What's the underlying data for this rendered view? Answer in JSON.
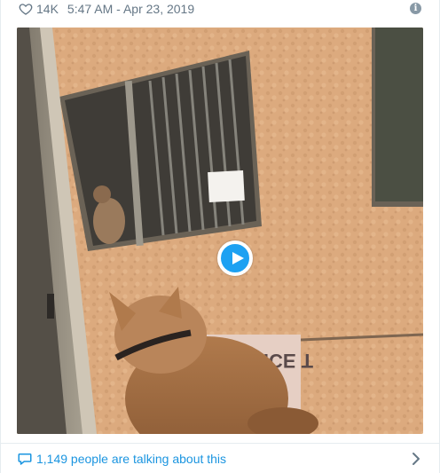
{
  "meta": {
    "like_count": "14K",
    "timestamp": "5:47 AM - Apr 23, 2019",
    "info_symbol": "i"
  },
  "media": {
    "type": "video",
    "sign_text": "NICE T"
  },
  "footer": {
    "conversation_text": "1,149 people are talking about this"
  },
  "colors": {
    "link": "#1b95e0",
    "play_button": "#1da1f2",
    "muted": "#657786",
    "wall": "#d9a679"
  },
  "icons": {
    "like": "heart-icon",
    "info": "info-icon",
    "play": "play-icon",
    "reply": "speech-bubble-icon",
    "more": "chevron-right-icon"
  }
}
